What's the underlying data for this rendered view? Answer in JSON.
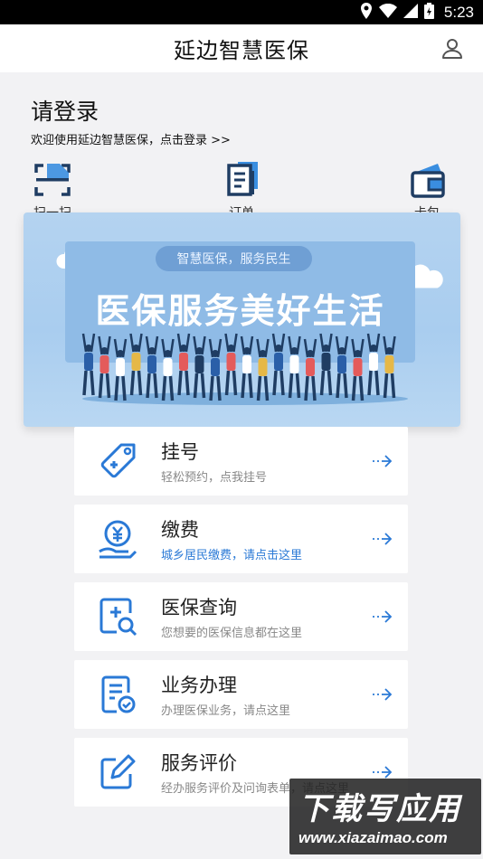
{
  "status_bar": {
    "time": "5:23",
    "icons": [
      "location-icon",
      "wifi-icon",
      "signal-icon",
      "battery-icon"
    ]
  },
  "app_bar": {
    "title": "延边智慧医保",
    "user_icon": "user-icon"
  },
  "login": {
    "title": "请登录",
    "subtitle": "欢迎使用延边智慧医保，点击登录 >>"
  },
  "quick_actions": [
    {
      "label": "扫一扫",
      "icon": "scan-icon"
    },
    {
      "label": "订单",
      "icon": "order-icon"
    },
    {
      "label": "卡包",
      "icon": "wallet-icon"
    }
  ],
  "banner": {
    "tag": "智慧医保，服务民生",
    "headline": "医保服务美好生活"
  },
  "menu": [
    {
      "title": "挂号",
      "subtitle": "轻松预约，点我挂号",
      "icon": "tag-icon",
      "highlight": false
    },
    {
      "title": "缴费",
      "subtitle": "城乡居民缴费，请点击这里",
      "icon": "payment-icon",
      "highlight": true
    },
    {
      "title": "医保查询",
      "subtitle": "您想要的医保信息都在这里",
      "icon": "search-record-icon",
      "highlight": false
    },
    {
      "title": "业务办理",
      "subtitle": "办理医保业务，请点这里",
      "icon": "document-check-icon",
      "highlight": false
    },
    {
      "title": "服务评价",
      "subtitle": "经办服务评价及问询表单，请点这里",
      "icon": "edit-icon",
      "highlight": false
    }
  ],
  "watermark": {
    "line1": "下载写应用",
    "line2": "www.xiazaimao.com"
  },
  "colors": {
    "accent": "#2a79d6",
    "banner_bg": "#b4d3f0",
    "page_bg": "#f2f2f4"
  }
}
